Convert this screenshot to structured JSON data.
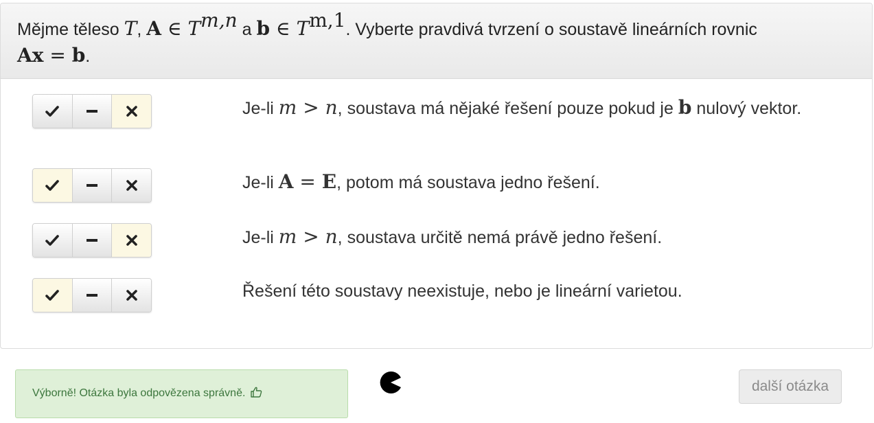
{
  "question": {
    "prefix": "Mějme těleso ",
    "t1": "T",
    "sep1": ", ",
    "A": "A",
    "in1": " ∈ ",
    "t2": "T",
    "sup1": "m,n",
    "and": " a ",
    "b": "b",
    "in2": " ∈ ",
    "t3": "T",
    "sup2": "m,1",
    "suffix": ". Vyberte pravdivá tvrzení o soustavě lineárních rovnic",
    "eqA": "A",
    "eqx": "x",
    "eq": " = ",
    "eqb": "b",
    "end": "."
  },
  "statements": [
    {
      "pre": "Je-li ",
      "m": "m",
      "gt": " > ",
      "n": "n",
      "mid": ", soustava má nějaké řešení pouze pokud je ",
      "bvec": "b",
      "post": " nulový vektor.",
      "selected": "false"
    },
    {
      "pre": "Je-li ",
      "A": "A",
      "eq": " = ",
      "E": "E",
      "post": ", potom má soustava jedno řešení.",
      "selected": "true"
    },
    {
      "pre": "Je-li ",
      "m": "m",
      "gt": " > ",
      "n": "n",
      "post": ", soustava určitě nemá právě jedno řešení.",
      "selected": "false"
    },
    {
      "text": "Řešení této soustavy neexistuje, nebo je lineární varietou.",
      "selected": "true"
    }
  ],
  "choices": [
    "true",
    "neutral",
    "false"
  ],
  "icons": {
    "true": "check-icon",
    "neutral": "minus-icon",
    "false": "times-icon",
    "feedback": "thumbs-up-icon",
    "loader": "pacman-icon"
  },
  "feedback": {
    "text": "Výborně! Otázka byla odpovězena správně."
  },
  "next_button": {
    "label": "další otázka"
  },
  "colors": {
    "active_choice": "#fcf8e3",
    "alert_bg": "#dff0d8",
    "alert_text": "#3c763d",
    "heading_bg": "#eeeeee"
  }
}
